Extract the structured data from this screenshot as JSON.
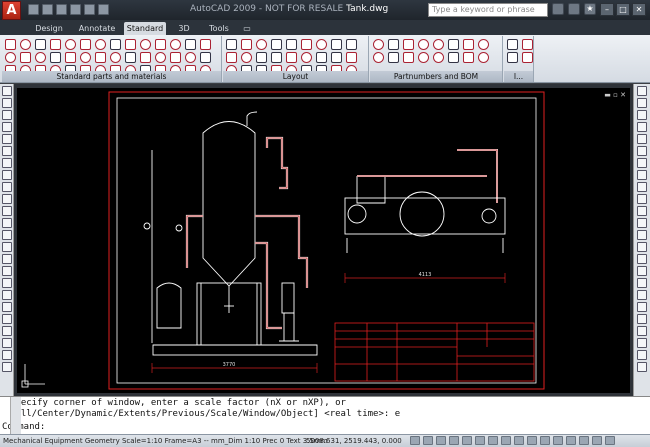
{
  "window": {
    "app_letter": "A",
    "app_title": "AutoCAD 2009 - NOT FOR RESALE",
    "file_name": "Tank.dwg",
    "search_placeholder": "Type a keyword or phrase"
  },
  "tabs": [
    {
      "label": "Design"
    },
    {
      "label": "Annotate"
    },
    {
      "label": "Standard",
      "active": true
    },
    {
      "label": "3D"
    },
    {
      "label": "Tools"
    }
  ],
  "ribbon_panels": [
    {
      "label": "Standard parts and materials"
    },
    {
      "label": "Layout"
    },
    {
      "label": "Partnumbers and BOM"
    },
    {
      "label": "I..."
    }
  ],
  "drawing": {
    "dimension_left": "3770",
    "dimension_right": "4113"
  },
  "command": {
    "line1": "Specify corner of window, enter a scale factor (nX or nXP), or",
    "line2": "[All/Center/Dynamic/Extents/Previous/Scale/Window/Object] <real time>: e",
    "prompt": "Command:"
  },
  "status": {
    "info": "Mechanical Equipment Geometry Scale=1:10 Frame=A3 -- mm_Dim 1:10 Prec 0 Text 3.5mm",
    "coordinates": "5008.631, 2519.443, 0.000"
  },
  "colors": {
    "drawing_bg": "#000000",
    "frame_line": "#e02020",
    "geometry_line": "#ffffff"
  }
}
